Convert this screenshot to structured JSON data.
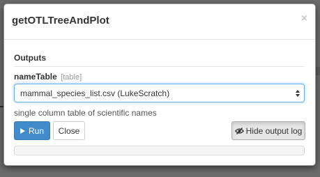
{
  "modal": {
    "title": "getOTLTreeAndPlot",
    "close_glyph": "×"
  },
  "outputs": {
    "heading": "Outputs",
    "field": {
      "name": "nameTable",
      "type": "[table]",
      "selected_value": "mammal_species_list.csv (LukeScratch)",
      "help": "single column table of scientific names"
    }
  },
  "buttons": {
    "run_label": "Run",
    "close_label": "Close",
    "hide_log_label": "Hide output log"
  },
  "progress": {
    "fraction": 0
  },
  "icons": {
    "run": "play-icon",
    "hide_log": "eye-slash-icon",
    "select": "select-arrows-icon"
  },
  "colors": {
    "primary": "#428bca",
    "focus_border": "#66afe9",
    "close_glyph": "#c8c8c8",
    "type_hint": "#999999"
  }
}
